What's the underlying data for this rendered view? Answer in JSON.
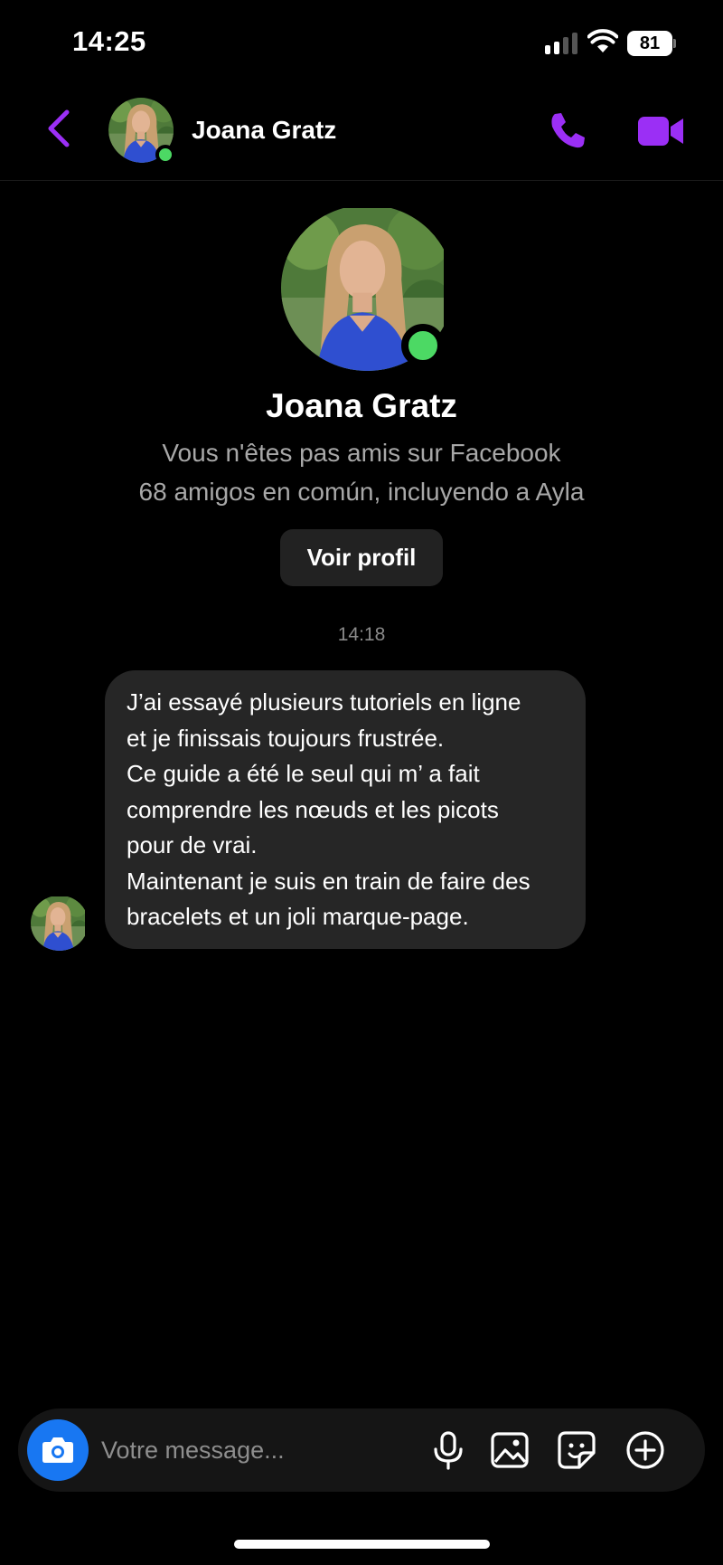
{
  "status_bar": {
    "time": "14:25",
    "battery": "81"
  },
  "header": {
    "contact_name": "Joana Gratz",
    "online": true
  },
  "profile": {
    "name": "Joana Gratz",
    "friend_status": "Vous n'êtes pas amis sur Facebook",
    "mutual_friends": "68 amigos en común, incluyendo a Ayla",
    "view_profile_label": "Voir profil"
  },
  "conversation": {
    "timestamp": "14:18",
    "message_lines": [
      "J’ai essayé plusieurs tutoriels en ligne",
      "et je finissais toujours frustrée.",
      "Ce guide a été le seul qui m’ a fait",
      "comprendre les nœuds et les picots",
      "pour de vrai.",
      "Maintenant je suis en train de faire des",
      "bracelets et un joli marque-page."
    ]
  },
  "composer": {
    "placeholder": "Votre message..."
  },
  "colors": {
    "accent": "#9b2ff5",
    "online": "#4cd964",
    "camera": "#1877f2",
    "bubble": "#262626"
  },
  "icons": {
    "back": "chevron-left-icon",
    "call": "phone-icon",
    "video": "video-camera-icon",
    "camera": "camera-icon",
    "mic": "microphone-icon",
    "gallery": "image-icon",
    "sticker": "sticker-icon",
    "plus": "plus-circle-icon"
  }
}
